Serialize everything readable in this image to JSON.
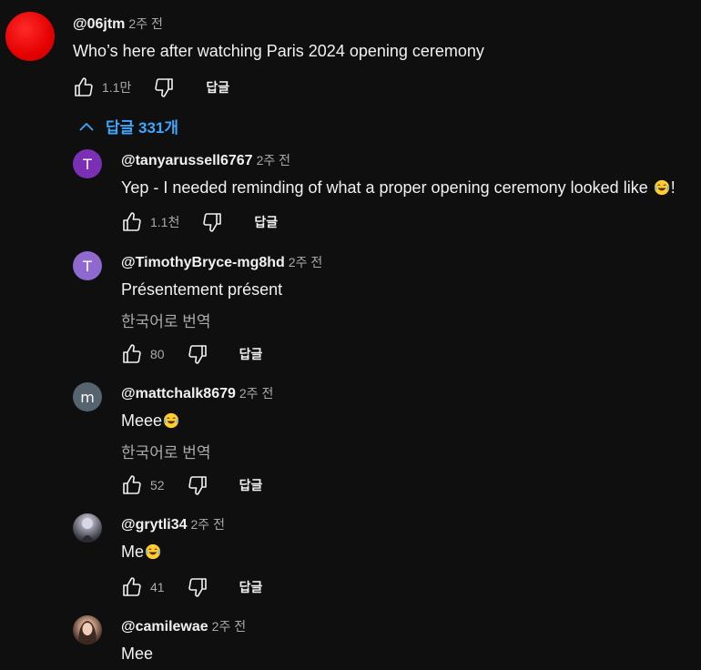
{
  "top_comment": {
    "handle": "@06jtm",
    "time": "2주 전",
    "text": "Who’s here after watching Paris 2024 opening ceremony",
    "likes": "1.1만",
    "reply_label": "답글",
    "avatar_color": "#e50000"
  },
  "replies_toggle": {
    "label": "답글 331개",
    "icon": "chevron-up-icon",
    "color": "#3ea6ff"
  },
  "replies": [
    {
      "avatar_letter": "T",
      "avatar_color": "#7b2fb5",
      "handle": "@tanyarussell6767",
      "time": "2주 전",
      "text": "Yep - I needed reminding of what a proper opening ceremony looked like",
      "text_suffix": "!",
      "likes": "1.1천",
      "reply_label": "답글"
    },
    {
      "avatar_letter": "T",
      "avatar_color": "#8e69cf",
      "handle": "@TimothyBryce-mg8hd",
      "time": "2주 전",
      "text": "Présentement présent",
      "translate": "한국어로 번역",
      "likes": "80",
      "reply_label": "답글"
    },
    {
      "avatar_letter": "m",
      "avatar_color": "#566470",
      "handle": "@mattchalk8679",
      "time": "2주 전",
      "text": "Meee",
      "translate": "한국어로 번역",
      "likes": "52",
      "reply_label": "답글"
    },
    {
      "handle": "@grytli34",
      "time": "2주 전",
      "text": "Me",
      "likes": "41",
      "reply_label": "답글"
    },
    {
      "handle": "@camilewae",
      "time": "2주 전",
      "text": "Mee"
    }
  ]
}
